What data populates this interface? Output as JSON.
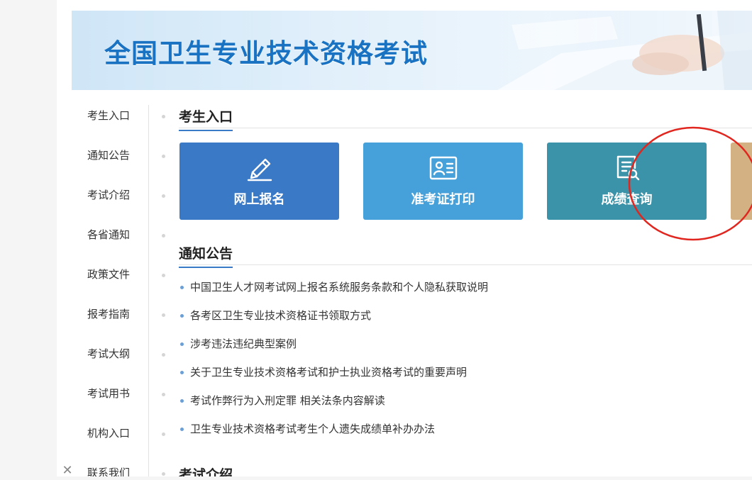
{
  "banner": {
    "title": "全国卫生专业技术资格考试"
  },
  "sidebar": {
    "items": [
      {
        "label": "考生入口"
      },
      {
        "label": "通知公告"
      },
      {
        "label": "考试介绍"
      },
      {
        "label": "各省通知"
      },
      {
        "label": "政策文件"
      },
      {
        "label": "报考指南"
      },
      {
        "label": "考试大纲"
      },
      {
        "label": "考试用书"
      },
      {
        "label": "机构入口"
      },
      {
        "label": "联系我们"
      }
    ]
  },
  "sections": {
    "candidate": {
      "title": "考生入口"
    },
    "notices": {
      "title": "通知公告"
    },
    "intro": {
      "title": "考试介绍"
    }
  },
  "tiles": [
    {
      "label": "网上报名",
      "icon": "pencil-icon",
      "color": "#3a79c6"
    },
    {
      "label": "准考证打印",
      "icon": "id-card-icon",
      "color": "#46a0d9"
    },
    {
      "label": "成绩查询",
      "icon": "score-search-icon",
      "color": "#3a93a8"
    },
    {
      "label": "",
      "icon": "",
      "color": "#d4b183"
    }
  ],
  "notices": [
    "中国卫生人才网考试网上报名系统服务条款和个人隐私获取说明",
    "各考区卫生专业技术资格证书领取方式",
    "涉考违法违纪典型案例",
    "关于卫生专业技术资格考试和护士执业资格考试的重要声明",
    "考试作弊行为入刑定罪 相关法条内容解读",
    "卫生专业技术资格考试考生个人遗失成绩单补办办法"
  ],
  "colors": {
    "accent": "#3a7bc8",
    "annotation": "#e0261f"
  },
  "close_icon": "close-icon"
}
